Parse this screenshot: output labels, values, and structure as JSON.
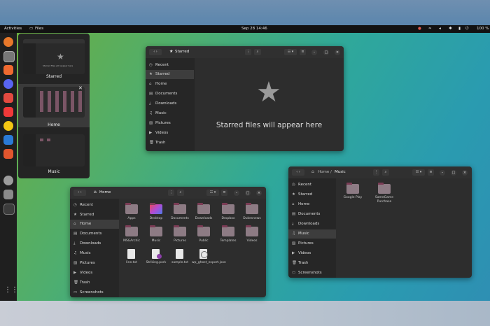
{
  "topbar": {
    "activities": "Activities",
    "app_name": "Files",
    "datetime": "Sep 28  14:46",
    "battery": "100 %"
  },
  "dock": {
    "apps": [
      "firefox",
      "files",
      "brave",
      "discord",
      "app-red",
      "vivaldi",
      "rhythmbox",
      "libreoffice-writer",
      "software",
      "settings",
      "trash-app",
      "terminal"
    ],
    "show_apps_icon": "grid-icon"
  },
  "overview": {
    "windows": [
      {
        "label": "Starred",
        "inner_text": "Starred files will appear here"
      },
      {
        "label": "Home"
      },
      {
        "label": "Music"
      }
    ]
  },
  "starred_window": {
    "title": "Starred",
    "sidebar": [
      "Recent",
      "Starred",
      "Home",
      "Documents",
      "Downloads",
      "Music",
      "Pictures",
      "Videos",
      "Trash"
    ],
    "empty_message": "Starred files will appear here"
  },
  "home_window": {
    "title": "Home",
    "sidebar": [
      "Recent",
      "Starred",
      "Home",
      "Documents",
      "Downloads",
      "Music",
      "Pictures",
      "Videos",
      "Trash",
      "Screenshots"
    ],
    "items": [
      {
        "name": "Apps",
        "kind": "folder"
      },
      {
        "name": "Desktop",
        "kind": "folder-desktop"
      },
      {
        "name": "Documents",
        "kind": "folder"
      },
      {
        "name": "Downloads",
        "kind": "folder"
      },
      {
        "name": "Dropbox",
        "kind": "folder"
      },
      {
        "name": "Dukesnews",
        "kind": "folder"
      },
      {
        "name": "MSGArchic",
        "kind": "folder"
      },
      {
        "name": "Music",
        "kind": "folder"
      },
      {
        "name": "Pictures",
        "kind": "folder"
      },
      {
        "name": "Public",
        "kind": "folder"
      },
      {
        "name": "Templates",
        "kind": "folder"
      },
      {
        "name": "Videos",
        "kind": "folder"
      },
      {
        "name": "line.txt",
        "kind": "doc"
      },
      {
        "name": "Striking.pork",
        "kind": "doc"
      },
      {
        "name": "sample.txt",
        "kind": "doc"
      },
      {
        "name": "wp_ghost_export.json",
        "kind": "json"
      }
    ]
  },
  "music_window": {
    "path_home": "Home",
    "path_current": "Music",
    "sidebar": [
      "Recent",
      "Starred",
      "Home",
      "Documents",
      "Downloads",
      "Music",
      "Pictures",
      "Videos",
      "Trash",
      "Screenshots"
    ],
    "items": [
      {
        "name": "Google Play"
      },
      {
        "name": "SameGame Purchase"
      }
    ]
  }
}
